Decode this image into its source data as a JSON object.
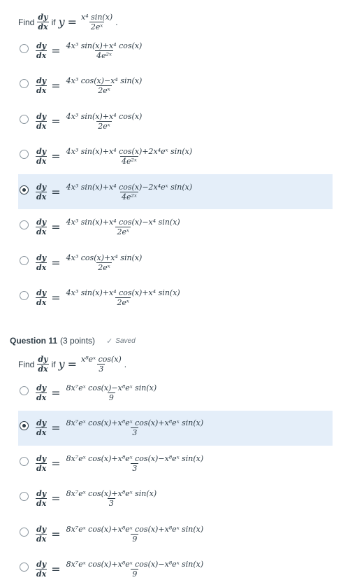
{
  "question10": {
    "prompt": {
      "find_label": "Find",
      "dy": "dy",
      "dx": "dx",
      "if_label": "if",
      "y": "y",
      "equals": "=",
      "rhs_num": "x⁴ sin(x)",
      "rhs_den": "2eˣ",
      "period": "."
    },
    "options": [
      {
        "num": "4x³ sin(x)+x⁴ cos(x)",
        "den": "4e²ˣ",
        "selected": false
      },
      {
        "num": "4x³ cos(x)−x⁴ sin(x)",
        "den": "2eˣ",
        "selected": false
      },
      {
        "num": "4x³ sin(x)+x⁴ cos(x)",
        "den": "2eˣ",
        "selected": false
      },
      {
        "num": "4x³ sin(x)+x⁴ cos(x)+2x⁴eˣ sin(x)",
        "den": "4e²ˣ",
        "selected": false
      },
      {
        "num": "4x³ sin(x)+x⁴ cos(x)−2x⁴eˣ sin(x)",
        "den": "4e²ˣ",
        "selected": true
      },
      {
        "num": "4x³ sin(x)+x⁴ cos(x)−x⁴ sin(x)",
        "den": "2eˣ",
        "selected": false
      },
      {
        "num": "4x³ cos(x)+x⁴ sin(x)",
        "den": "2eˣ",
        "selected": false
      },
      {
        "num": "4x³ sin(x)+x⁴ cos(x)+x⁴ sin(x)",
        "den": "2eˣ",
        "selected": false
      }
    ]
  },
  "question11": {
    "title": "Question 11",
    "points": "(3 points)",
    "status": "Saved",
    "prompt": {
      "find_label": "Find",
      "dy": "dy",
      "dx": "dx",
      "if_label": "if",
      "y": "y",
      "equals": "=",
      "rhs_num": "x⁸eˣ cos(x)",
      "rhs_den": "3",
      "period": "."
    },
    "options": [
      {
        "num": "8x⁷eˣ cos(x)−x⁸eˣ sin(x)",
        "den": "9",
        "selected": false
      },
      {
        "num": "8x⁷eˣ cos(x)+x⁸eˣ cos(x)+x⁸eˣ sin(x)",
        "den": "3",
        "selected": true
      },
      {
        "num": "8x⁷eˣ cos(x)+x⁸eˣ cos(x)−x⁸eˣ sin(x)",
        "den": "3",
        "selected": false
      },
      {
        "num": "8x⁷eˣ cos(x)+x⁸eˣ sin(x)",
        "den": "3",
        "selected": false
      },
      {
        "num": "8x⁷eˣ cos(x)+x⁸eˣ cos(x)+x⁸eˣ sin(x)",
        "den": "9",
        "selected": false
      },
      {
        "num": "8x⁷eˣ cos(x)+x⁸eˣ cos(x)−x⁸eˣ sin(x)",
        "den": "9",
        "selected": false
      }
    ]
  }
}
